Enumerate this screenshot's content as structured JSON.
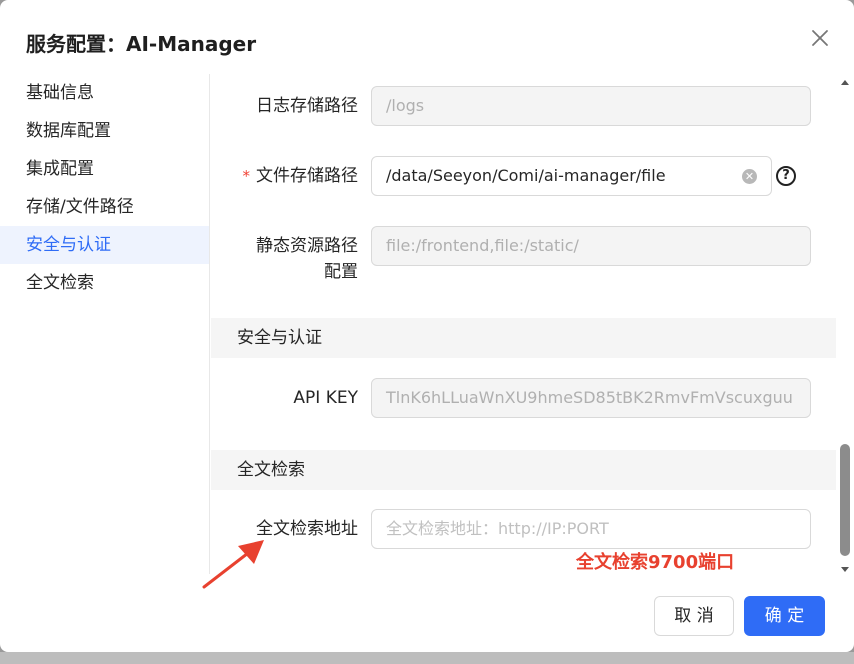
{
  "dialog": {
    "title": "服务配置：AI-Manager",
    "close_icon": "close-icon"
  },
  "sidebar": {
    "items": [
      {
        "label": "基础信息",
        "active": false
      },
      {
        "label": "数据库配置",
        "active": false
      },
      {
        "label": "集成配置",
        "active": false
      },
      {
        "label": "存储/文件路径",
        "active": false
      },
      {
        "label": "安全与认证",
        "active": true
      },
      {
        "label": "全文检索",
        "active": false
      }
    ]
  },
  "form": {
    "log_path": {
      "label": "日志存储路径",
      "value": "/logs"
    },
    "file_path": {
      "required_mark": "*",
      "label": "文件存储路径",
      "value": "/data/Seeyon/Comi/ai-manager/file",
      "clear_icon": "clear-circle-icon",
      "help_icon": "question-circle-icon",
      "help_glyph": "?"
    },
    "static_path": {
      "label_line1": "静态资源路径",
      "label_line2": "配置",
      "value": "file:/frontend,file:/static/"
    },
    "security_section": {
      "title": "安全与认证"
    },
    "api_key": {
      "label": "API KEY",
      "value": "TlnK6hLLuaWnXU9hmeSD85tBK2RmvFmVscuxguu"
    },
    "search_section": {
      "title": "全文检索"
    },
    "search_address": {
      "label": "全文检索地址",
      "placeholder": "全文检索地址：http://IP:PORT"
    }
  },
  "annotation": {
    "text": "全文检索9700端口",
    "color": "#e8412f"
  },
  "footer": {
    "cancel_label": "取 消",
    "ok_label": "确 定"
  },
  "colors": {
    "accent": "#2f6cf6",
    "active_bg": "#eef3fe",
    "required": "#f04134"
  }
}
